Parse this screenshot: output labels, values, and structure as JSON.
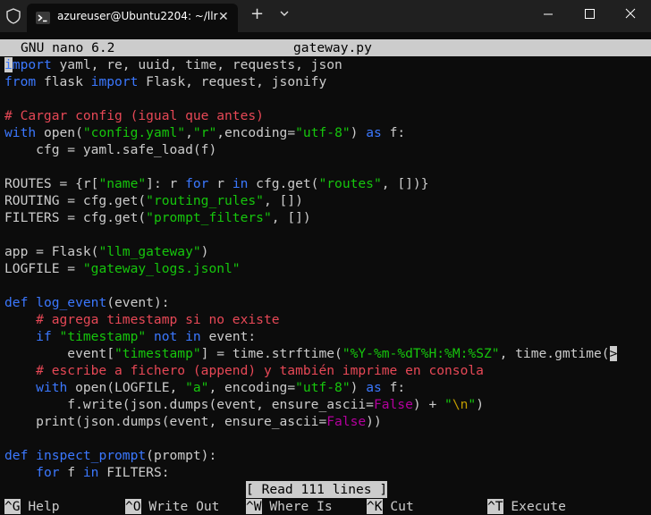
{
  "window": {
    "tab_title": "azureuser@Ubuntu2204: ~/llr",
    "tab_close": "✕",
    "new_tab": "+",
    "dropdown_icon": "chevron-down-icon",
    "shield_icon": "shield-icon",
    "terminal_icon": "terminal-icon"
  },
  "nano": {
    "version": "GNU nano 6.2",
    "filename": "gateway.py",
    "status_message": "[ Read 111 lines ]",
    "shortcuts": [
      {
        "key": "^G",
        "label": "Help"
      },
      {
        "key": "^O",
        "label": "Write Out"
      },
      {
        "key": "^W",
        "label": "Where Is"
      },
      {
        "key": "^K",
        "label": "Cut"
      },
      {
        "key": "^T",
        "label": "Execute"
      }
    ]
  },
  "code": {
    "l1": {
      "c": "i",
      "kw": "mport",
      "rest": " yaml, re, uuid, time, requests, json"
    },
    "l2": {
      "kw1": "from",
      "mid": " flask ",
      "kw2": "import",
      "rest": " Flask, request, jsonify"
    },
    "l4": "# Cargar config (igual que antes)",
    "l5": {
      "kw": "with",
      "a": " open(",
      "s1": "\"config.yaml\"",
      "b": ",",
      "s2": "\"r\"",
      "c": ",encoding=",
      "s3": "\"utf-8\"",
      "d": ") ",
      "kw2": "as",
      "e": " f:"
    },
    "l6": "    cfg = yaml.safe_load(f)",
    "l8": {
      "a": "ROUTES = {r[",
      "s1": "\"name\"",
      "b": "]: r ",
      "kw1": "for",
      "c": " r ",
      "kw2": "in",
      "d": " cfg.get(",
      "s2": "\"routes\"",
      "e": ", [])}"
    },
    "l9": {
      "a": "ROUTING = cfg.get(",
      "s": "\"routing_rules\"",
      "b": ", [])"
    },
    "l10": {
      "a": "FILTERS = cfg.get(",
      "s": "\"prompt_filters\"",
      "b": ", [])"
    },
    "l12": {
      "a": "app = Flask(",
      "s": "\"llm_gateway\"",
      "b": ")"
    },
    "l13": {
      "a": "LOGFILE = ",
      "s": "\"gateway_logs.jsonl\""
    },
    "l15": {
      "kw": "def",
      "sp": " ",
      "fn": "log_event",
      "rest": "(event):"
    },
    "l16": "    # agrega timestamp si no existe",
    "l17": {
      "ind": "    ",
      "kw": "if",
      "sp": " ",
      "s": "\"timestamp\"",
      "sp2": " ",
      "kw2": "not",
      "sp3": " ",
      "kw3": "in",
      "rest": " event:"
    },
    "l18": {
      "a": "        event[",
      "s1": "\"timestamp\"",
      "b": "] = time.strftime(",
      "s2": "\"%Y-%m-%dT%H:%M:%SZ\"",
      "c": ", time.gmtime(",
      "more": ">"
    },
    "l19": "    # escribe a fichero (append) y también imprime en consola",
    "l20": {
      "ind": "    ",
      "kw": "with",
      "a": " open(LOGFILE, ",
      "s1": "\"a\"",
      "b": ", encoding=",
      "s2": "\"utf-8\"",
      "c": ") ",
      "kw2": "as",
      "d": " f:"
    },
    "l21": {
      "a": "        f.write(json.dumps(event, ensure_ascii=",
      "bo": "False",
      "b": ") + ",
      "q1": "\"",
      "esc": "\\n",
      "q2": "\"",
      "c": ")"
    },
    "l22": {
      "a": "    print(json.dumps(event, ensure_ascii=",
      "bo": "False",
      "b": "))"
    },
    "l24": {
      "kw": "def",
      "sp": " ",
      "fn": "inspect_prompt",
      "rest": "(prompt):"
    },
    "l25": {
      "ind": "    ",
      "kw": "for",
      "a": " f ",
      "kw2": "in",
      "b": " FILTERS:"
    }
  }
}
